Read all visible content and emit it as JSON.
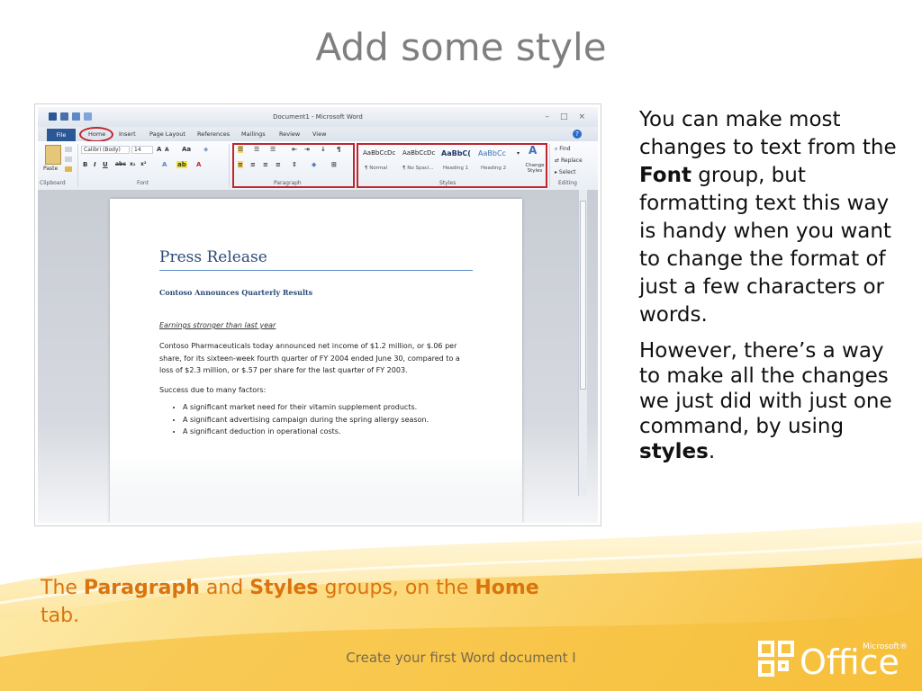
{
  "slide": {
    "title": "Add some style",
    "side_text_1_parts": [
      "You can make most changes to text from the ",
      "Font",
      " group, but formatting text this way is handy when you want to change the format of just a few characters or words."
    ],
    "side_text_2_parts": [
      "However, there’s a way to make all the changes we just did with just one command, by using ",
      "styles",
      "."
    ],
    "caption_parts": [
      "The ",
      "Paragraph",
      " and ",
      "Styles",
      " groups, on the ",
      "Home",
      " tab."
    ],
    "footer": "Create your first Word document I"
  },
  "logo": {
    "word": "Office",
    "superscript": "Microsoft®"
  },
  "word_window": {
    "title": "Document1 - Microsoft Word",
    "tabs": [
      "File",
      "Home",
      "Insert",
      "Page Layout",
      "References",
      "Mailings",
      "Review",
      "View"
    ],
    "groups": [
      "Clipboard",
      "Font",
      "Paragraph",
      "Styles",
      "Editing"
    ],
    "font_name": "Calibri (Body)",
    "font_size": "14",
    "paste_label": "Paste",
    "styles": [
      {
        "sample": "AaBbCcDc",
        "name": "¶ Normal"
      },
      {
        "sample": "AaBbCcDc",
        "name": "¶ No Spaci..."
      },
      {
        "sample": "AaBbC(",
        "name": "Heading 1"
      },
      {
        "sample": "AaBbCc",
        "name": "Heading 2"
      }
    ],
    "change_styles_label": "Change Styles",
    "editing": [
      "Find",
      "Replace",
      "Select"
    ]
  },
  "document": {
    "title": "Press Release",
    "subtitle": "Contoso Announces Quarterly Results",
    "lead": "Earnings stronger than last year",
    "body": "Contoso Pharmaceuticals today announced net income of $1.2 million, or $.06 per share, for its sixteen-week fourth quarter of FY 2004 ended June 30, compared to a loss of $2.3 million, or $.57 per share for the last quarter of FY 2003.",
    "factors_heading": "Success due to many factors:",
    "factors": [
      "A significant market need for their vitamin supplement products.",
      "A significant advertising campaign during the spring allergy season.",
      "A significant deduction in operational costs."
    ]
  },
  "colors": {
    "title": "#7f7f7f",
    "caption": "#d9740f",
    "highlight": "#c0262f",
    "doc_heading": "#2b4a76"
  }
}
